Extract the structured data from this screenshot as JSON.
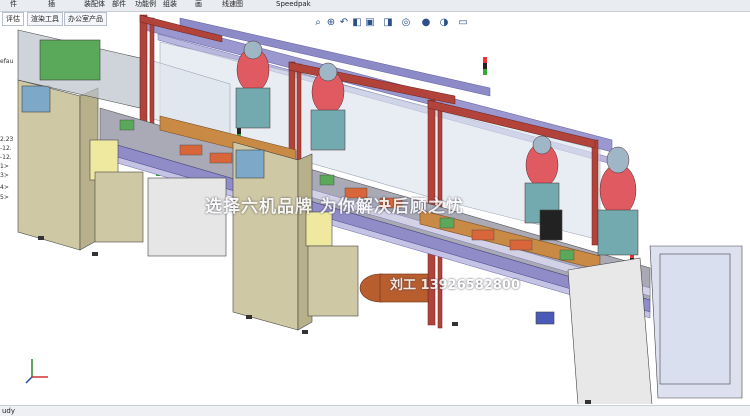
{
  "toolbar": {
    "items": [
      "件",
      "插",
      "装配体",
      "部件",
      "功能例",
      "组装",
      "画",
      "线速图",
      "Speedpak"
    ]
  },
  "tabs": [
    "评估",
    "渲染工具",
    "办公室产品"
  ],
  "tree": {
    "labels": [
      "efau",
      "2.23",
      "-12.",
      "-12.",
      "1>",
      "3>",
      "4>",
      "5>"
    ]
  },
  "view_toolbar": {
    "icons": [
      "zoom-fit-icon",
      "zoom-area-icon",
      "previous-view-icon",
      "section-view-icon",
      "view-orientation-icon",
      "display-style-icon",
      "hide-show-icon",
      "edit-appearance-icon",
      "scene-icon",
      "view-settings-icon"
    ]
  },
  "status": {
    "text": "udy"
  },
  "watermark": {
    "line1": "选择六机品牌 为你解决后顾之忧",
    "line2": "刘工 13926582800"
  },
  "colors": {
    "frame_red": "#b2433a",
    "panel_tan": "#cfc8a4",
    "glass": "#d9e2ea",
    "conveyor_purple": "#8f8cc7",
    "robot_pink": "#e05a61",
    "robot_teal": "#72aab0",
    "wood": "#c98a45"
  }
}
